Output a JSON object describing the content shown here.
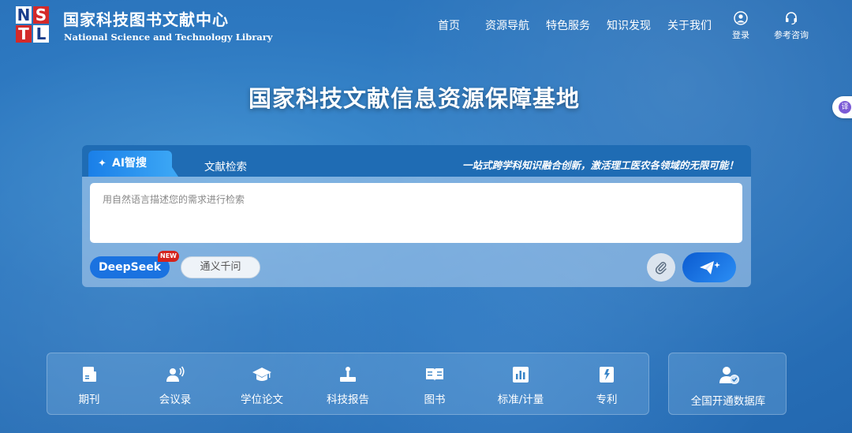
{
  "brand": {
    "logo_letters": [
      "N",
      "S",
      "T",
      "L"
    ],
    "name_cn": "国家科技图书文献中心",
    "name_en": "National Science and Technology Library"
  },
  "nav": {
    "items": [
      {
        "label": "首页"
      },
      {
        "label": "资源导航"
      },
      {
        "label": "特色服务"
      },
      {
        "label": "知识发现"
      },
      {
        "label": "关于我们"
      }
    ],
    "login_label": "登录",
    "consult_label": "参考咨询"
  },
  "side_widget": {
    "label": "译"
  },
  "hero": {
    "title": "国家科技文献信息资源保障基地"
  },
  "search": {
    "tabs": [
      {
        "label": "AI智搜",
        "active": true
      },
      {
        "label": "文献检索",
        "active": false
      }
    ],
    "slogan": "一站式跨学科知识融合创新，激活理工医农各领域的无限可能！",
    "placeholder": "用自然语言描述您的需求进行检索",
    "value": "",
    "models": [
      {
        "label": "DeepSeek",
        "badge": "NEW",
        "selected": true
      },
      {
        "label": "通义千问",
        "selected": false
      }
    ],
    "attach_icon": "paperclip-icon",
    "send_icon": "paper-plane-icon"
  },
  "categories": {
    "items": [
      {
        "label": "期刊",
        "icon": "journal-icon"
      },
      {
        "label": "会议录",
        "icon": "conference-icon"
      },
      {
        "label": "学位论文",
        "icon": "graduation-cap-icon"
      },
      {
        "label": "科技报告",
        "icon": "report-icon"
      },
      {
        "label": "图书",
        "icon": "book-icon"
      },
      {
        "label": "标准/计量",
        "icon": "chart-icon"
      },
      {
        "label": "专利",
        "icon": "patent-icon"
      }
    ],
    "database": {
      "label": "全国开通数据库",
      "icon": "user-check-icon"
    }
  },
  "colors": {
    "background": "#2d78c0",
    "tab_bar": "#1f6cb4",
    "accent": "#1a72e0",
    "badge": "#d4231c"
  }
}
